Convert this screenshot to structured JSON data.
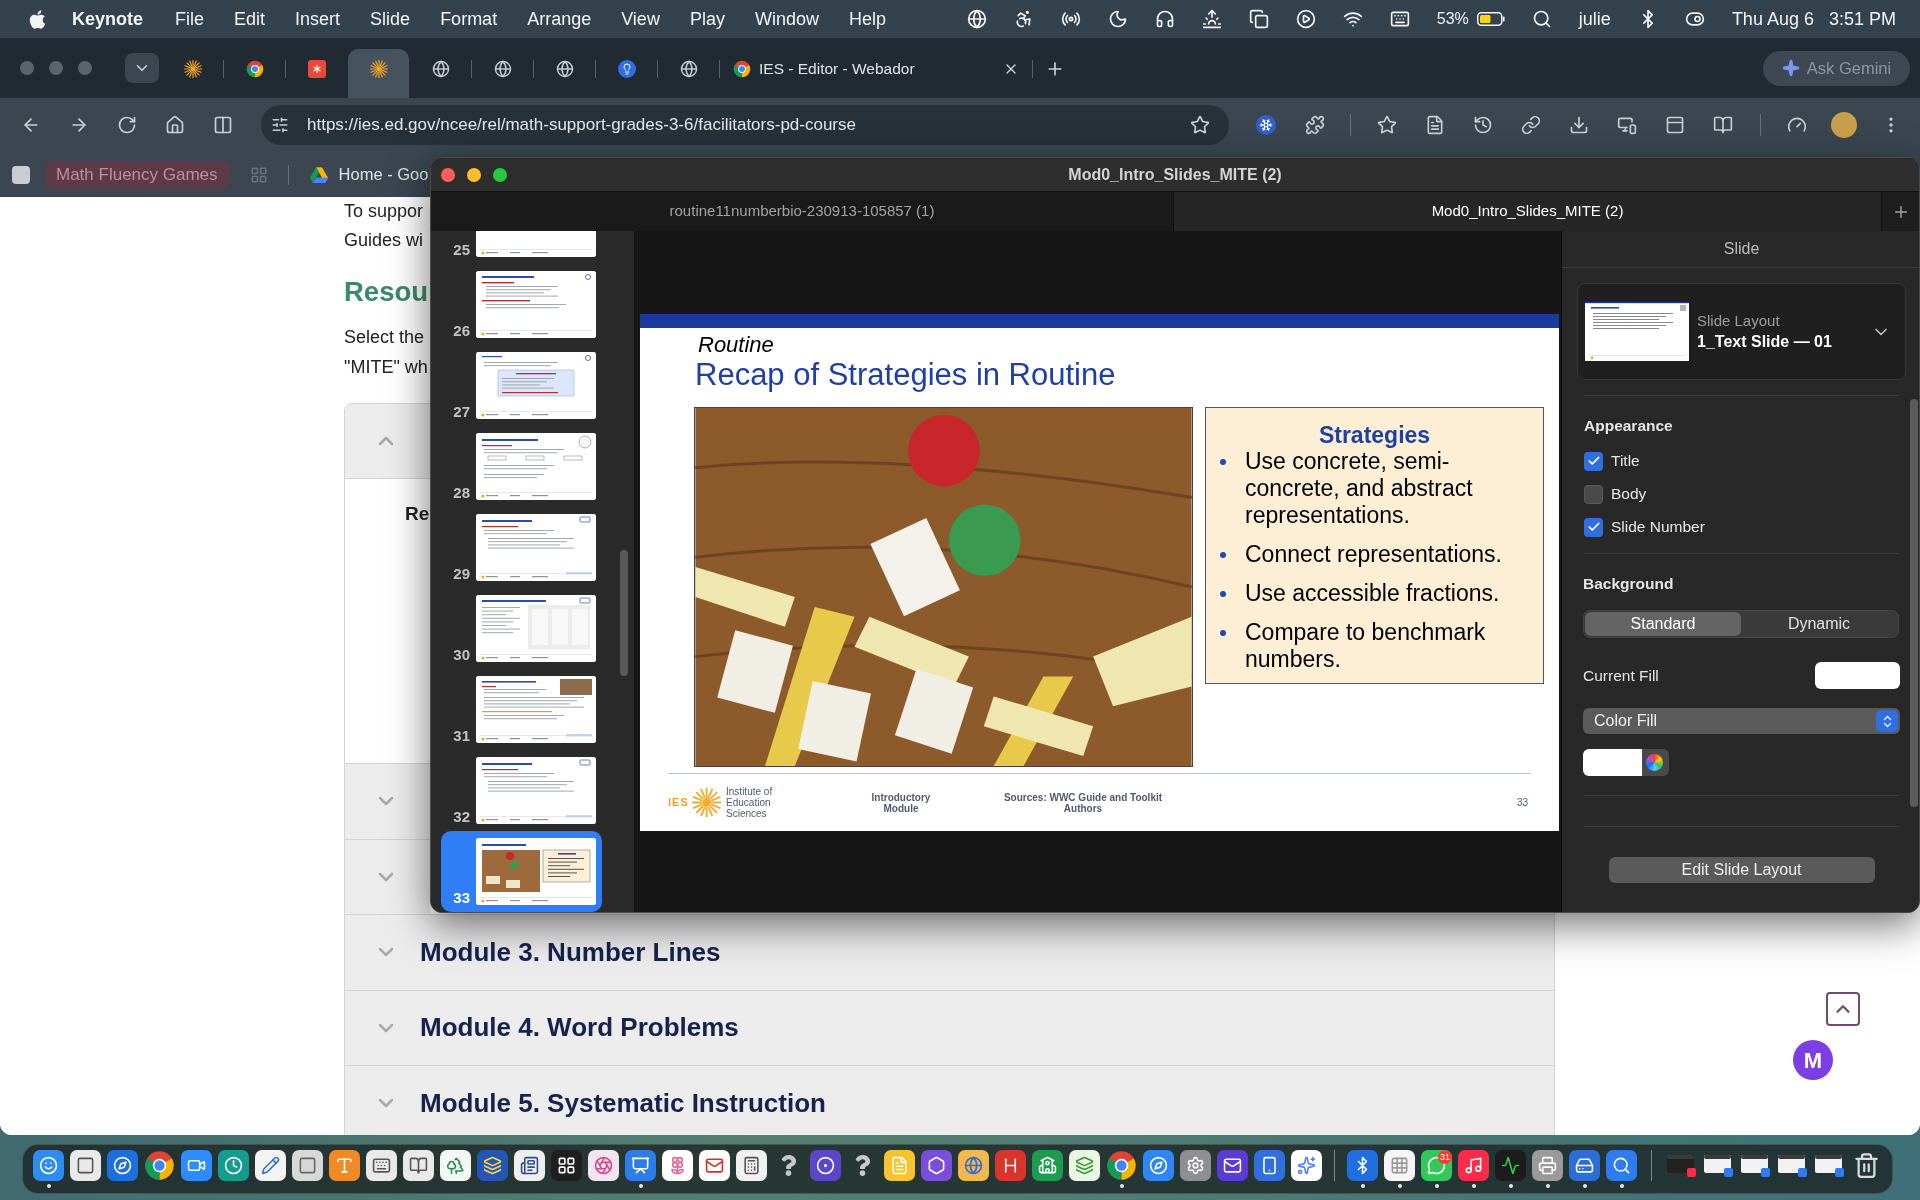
{
  "menubar": {
    "app": "Keynote",
    "menus": [
      "File",
      "Edit",
      "Insert",
      "Slide",
      "Format",
      "Arrange",
      "View",
      "Play",
      "Window",
      "Help"
    ],
    "battery": "53%",
    "user": "julie",
    "date": "Thu Aug 6",
    "time": "3:51 PM"
  },
  "browser": {
    "tabs": [
      {
        "selected": false
      },
      {
        "selected": false
      },
      {
        "selected": false
      },
      {
        "selected": true
      },
      {
        "selected": false
      },
      {
        "selected": false
      },
      {
        "selected": false
      },
      {
        "selected": false
      },
      {
        "selected": false
      },
      {
        "title": "IES - Editor - Webador",
        "selected": false
      }
    ],
    "gemini_button": "Ask Gemini",
    "url": "https://ies.ed.gov/ncee/rel/math-support-grades-3-6/facilitators-pd-course",
    "bookmarks": [
      {
        "kind": "group",
        "title": "Math Fluency Games"
      },
      {
        "kind": "link",
        "title": "Home - Goo"
      }
    ]
  },
  "page": {
    "intro": [
      "To suppor",
      "Guides wi"
    ],
    "heading": "Resou",
    "select": [
      "Select the",
      "\"MITE\" wh"
    ],
    "accordion": [
      {
        "expanded": true,
        "content": "Re"
      },
      {
        "expanded": false
      },
      {
        "expanded": false
      },
      {
        "title": "Module 3. Number Lines",
        "expanded": false
      },
      {
        "title": "Module 4. Word Problems",
        "expanded": false
      },
      {
        "title": "Module 5. Systematic Instruction",
        "expanded": false
      }
    ],
    "chat_button": "M"
  },
  "keynote": {
    "title": "Mod0_Intro_Slides_MITE (2)",
    "tabs": [
      {
        "title": "routine11numberbio-230913-105857 (1)",
        "selected": false
      },
      {
        "title": "Mod0_Intro_Slides_MITE (2)",
        "selected": true
      }
    ],
    "slides": [
      {
        "number": "25",
        "kind": "cards",
        "selected": false
      },
      {
        "number": "26",
        "kind": "bullets",
        "selected": false
      },
      {
        "number": "27",
        "kind": "callout",
        "selected": false
      },
      {
        "number": "28",
        "kind": "steps",
        "selected": false
      },
      {
        "number": "29",
        "kind": "discussion",
        "selected": false
      },
      {
        "number": "30",
        "kind": "gallery",
        "selected": false
      },
      {
        "number": "31",
        "kind": "video",
        "selected": false
      },
      {
        "number": "32",
        "kind": "discussion",
        "selected": false
      },
      {
        "number": "33",
        "kind": "recap",
        "selected": true
      }
    ],
    "slide": {
      "kicker": "Routine",
      "title": "Recap of Strategies in Routine",
      "box_title": "Strategies",
      "bullets": [
        "Use concrete, semi-concrete, and abstract representations.",
        "Connect representations.",
        "Use accessible fractions.",
        "Compare to benchmark numbers."
      ],
      "footer": {
        "logo_mark": "IES",
        "institute": "Institute of Education Sciences",
        "module": "Introductory Module",
        "sources": "Sources: WWC Guide and Toolkit Authors",
        "page": "33"
      }
    },
    "inspector": {
      "title": "Slide",
      "layout_label": "Slide Layout",
      "layout_name": "1_Text Slide — 01",
      "appearance_title": "Appearance",
      "appearance": [
        {
          "label": "Title",
          "checked": true
        },
        {
          "label": "Body",
          "checked": false
        },
        {
          "label": "Slide Number",
          "checked": true
        }
      ],
      "background_title": "Background",
      "background_modes": [
        {
          "label": "Standard",
          "selected": true
        },
        {
          "label": "Dynamic",
          "selected": false
        }
      ],
      "fill_label": "Current Fill",
      "fill_type": "Color Fill",
      "edit_button": "Edit Slide Layout"
    }
  },
  "dock": {
    "apps": [
      {
        "running": true
      },
      {
        "running": false
      },
      {
        "running": false
      },
      {
        "running": false
      },
      {
        "running": false
      },
      {
        "running": false
      },
      {
        "running": false
      },
      {
        "running": false
      },
      {
        "running": false
      },
      {
        "running": false
      },
      {
        "running": false
      },
      {
        "running": false
      },
      {
        "running": false
      },
      {
        "running": false
      },
      {
        "running": false
      },
      {
        "running": false
      },
      {
        "running": true
      },
      {
        "running": false
      },
      {
        "running": false
      },
      {
        "running": false
      },
      {
        "running": false
      },
      {
        "running": false
      },
      {
        "running": false
      },
      {
        "running": false
      },
      {
        "running": false
      },
      {
        "running": false
      },
      {
        "running": false
      },
      {
        "running": false
      },
      {
        "running": false
      },
      {
        "running": true
      },
      {
        "running": false
      },
      {
        "running": false
      },
      {
        "running": false
      },
      {
        "running": false
      },
      {
        "running": false
      }
    ],
    "utilities": [
      {
        "running": true
      },
      {
        "running": true
      },
      {
        "running": true,
        "badge": "31"
      },
      {
        "running": true
      },
      {
        "running": true
      },
      {
        "running": true
      },
      {
        "running": true
      },
      {
        "running": true
      }
    ]
  }
}
